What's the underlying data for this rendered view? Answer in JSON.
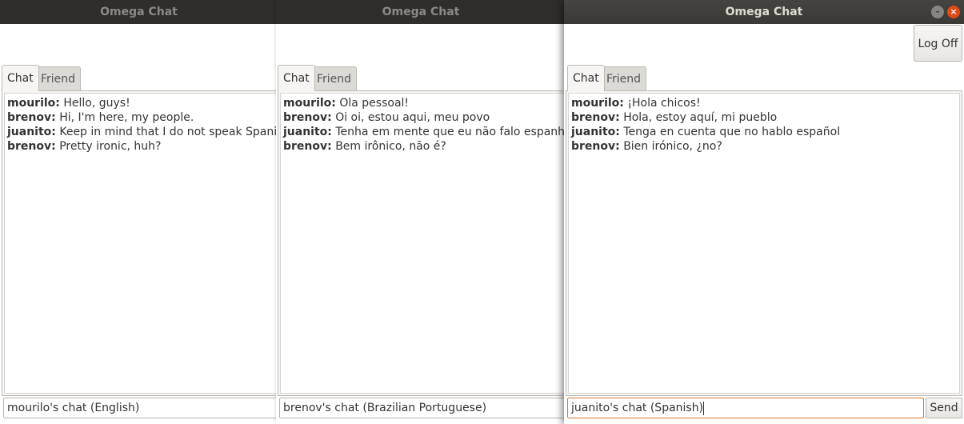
{
  "windows": [
    {
      "title": "Omega Chat",
      "tabs": [
        "Chat",
        "Friend List"
      ],
      "messages": [
        {
          "user": "mourilo:",
          "text": "Hello, guys!"
        },
        {
          "user": "brenov:",
          "text": "Hi, I'm here, my people."
        },
        {
          "user": "juanito:",
          "text": "Keep in mind that I do not speak Spanish"
        },
        {
          "user": "brenov:",
          "text": "Pretty ironic, huh?"
        }
      ],
      "input_value": "mourilo's chat (English)"
    },
    {
      "title": "Omega Chat",
      "tabs": [
        "Chat",
        "Friend List"
      ],
      "messages": [
        {
          "user": "mourilo:",
          "text": "Ola pessoal!"
        },
        {
          "user": "brenov:",
          "text": "Oi oi, estou aqui, meu povo"
        },
        {
          "user": "juanito:",
          "text": "Tenha em mente que eu não falo espanhol"
        },
        {
          "user": "brenov:",
          "text": "Bem irônico, não é?"
        }
      ],
      "input_value": "brenov's chat (Brazilian Portuguese)"
    },
    {
      "title": "Omega Chat",
      "logoff_label": "Log Off",
      "tabs": [
        "Chat",
        "Friend List"
      ],
      "messages": [
        {
          "user": "mourilo:",
          "text": "¡Hola chicos!"
        },
        {
          "user": "brenov:",
          "text": "Hola, estoy aquí, mi pueblo"
        },
        {
          "user": "juanito:",
          "text": "Tenga en cuenta que no hablo español"
        },
        {
          "user": "brenov:",
          "text": "Bien irónico, ¿no?"
        }
      ],
      "input_value": "juanito's chat (Spanish)",
      "send_label": "Send",
      "window_controls": {
        "minimize_icon": "minimize-icon",
        "close_icon": "close-icon"
      }
    }
  ],
  "colors": {
    "titlebar": "#3c3b37",
    "close": "#df4a16",
    "focus": "#e0732e"
  }
}
